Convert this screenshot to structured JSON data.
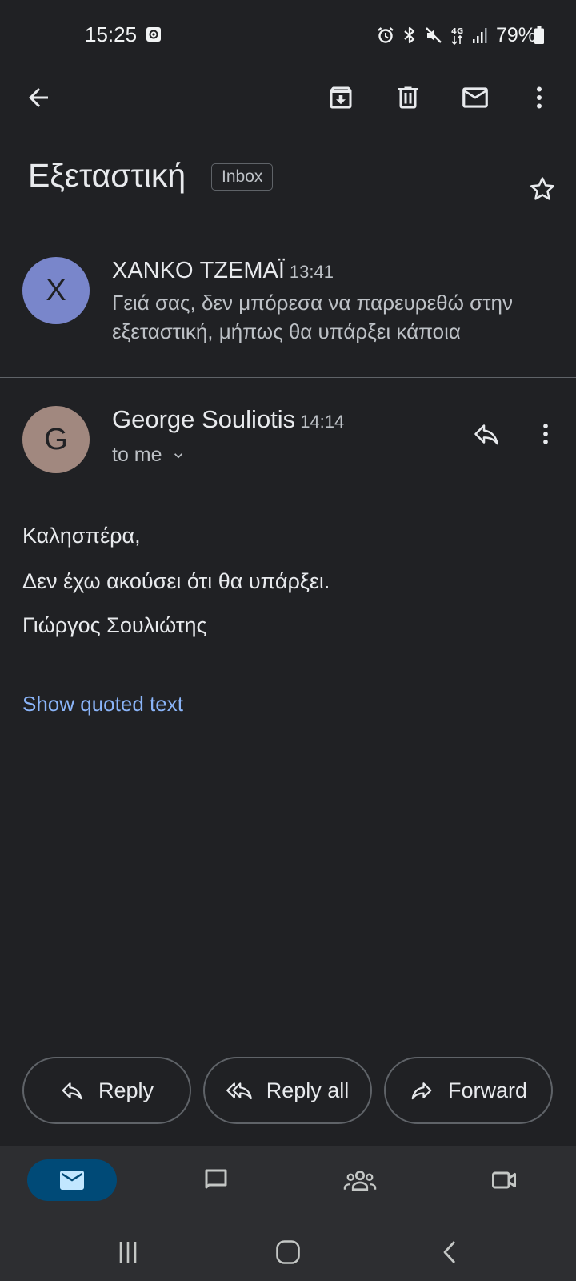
{
  "status_bar": {
    "time": "15:25",
    "battery_percent": "79%",
    "battery_level": 0.79,
    "network": "4G"
  },
  "toolbar": {
    "icons": [
      "back-arrow-icon",
      "archive-icon",
      "delete-icon",
      "mark-unread-icon",
      "more-vert-icon"
    ]
  },
  "thread": {
    "subject": "Εξεταστική",
    "label": "Inbox"
  },
  "collapsed_message": {
    "avatar_letter": "X",
    "avatar_color": "#7986cb",
    "sender": "XANKO ΤΖΕΜΑΪ",
    "time": "13:41",
    "snippet": "Γειά σας, δεν μπόρεσα να παρευρεθώ στην εξεταστική, μήπως θα υπάρξει κάποια"
  },
  "open_message": {
    "avatar_letter": "G",
    "avatar_color": "#a1887f",
    "sender": "George Souliotis",
    "time": "14:14",
    "recipient": "to me",
    "body": [
      "Καλησπέρα,",
      "Δεν έχω ακούσει ότι θα υπάρξει.",
      "Γιώργος Σουλιώτης"
    ],
    "show_quoted": "Show quoted text"
  },
  "actions": {
    "reply": "Reply",
    "reply_all": "Reply all",
    "forward": "Forward"
  },
  "bottom_nav": {
    "items": [
      "mail-icon",
      "chat-icon",
      "spaces-icon",
      "meet-icon"
    ],
    "active": "mail"
  },
  "colors": {
    "background": "#202124",
    "link": "#8ab4f8",
    "nav_active": "#004a77"
  }
}
